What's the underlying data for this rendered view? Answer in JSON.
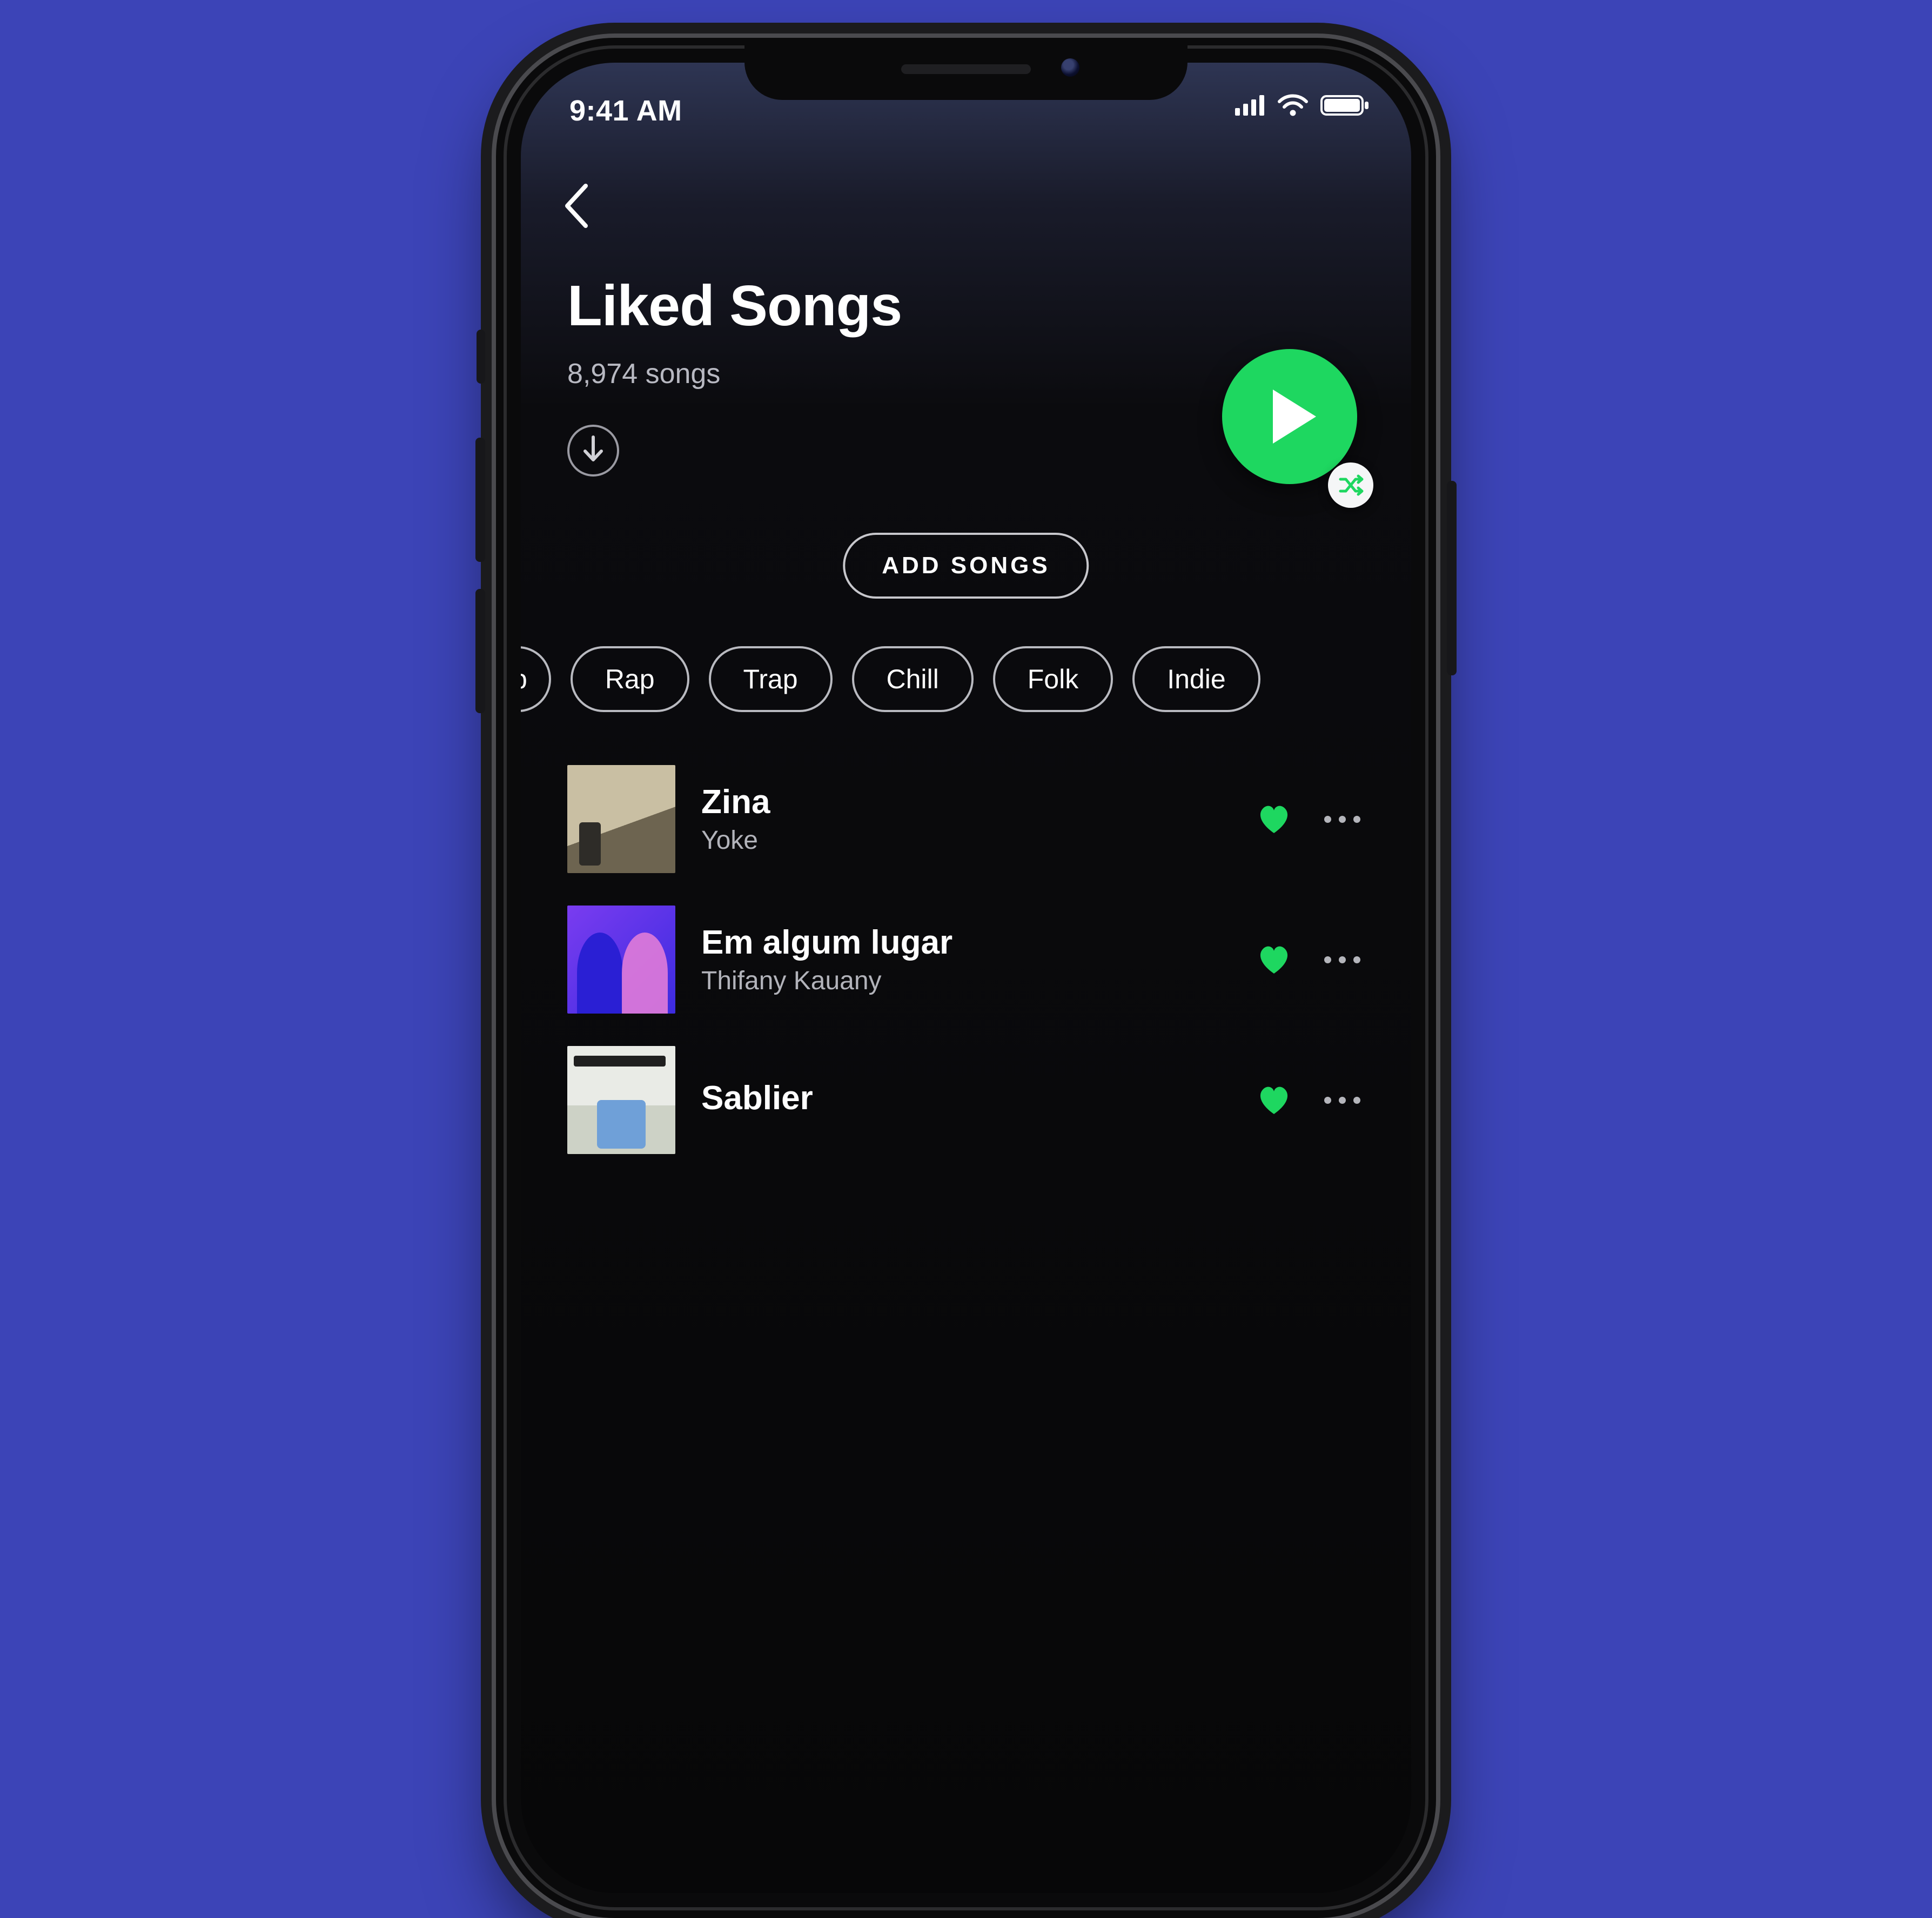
{
  "status": {
    "time": "9:41 AM"
  },
  "header": {
    "title": "Liked Songs",
    "subtitle": "8,974 songs",
    "add_songs_label": "ADD SONGS"
  },
  "icons": {
    "back": "chevron-left-icon",
    "download": "download-icon",
    "play": "play-icon",
    "shuffle": "shuffle-icon",
    "signal": "signal-icon",
    "wifi": "wifi-icon",
    "battery": "battery-icon",
    "heart": "heart-icon",
    "more": "more-icon"
  },
  "filters": [
    {
      "label": "p",
      "clipped": true
    },
    {
      "label": "Rap"
    },
    {
      "label": "Trap"
    },
    {
      "label": "Chill"
    },
    {
      "label": "Folk"
    },
    {
      "label": "Indie"
    }
  ],
  "songs": [
    {
      "title": "Zina",
      "artist": "Yoke",
      "liked": true,
      "art": "art1"
    },
    {
      "title": "Em algum lugar",
      "artist": "Thifany Kauany",
      "liked": true,
      "art": "art2"
    },
    {
      "title": "Sablier",
      "artist": "",
      "liked": true,
      "art": "art3"
    }
  ],
  "colors": {
    "accent": "#1ed760",
    "background": "#3c44b7"
  }
}
